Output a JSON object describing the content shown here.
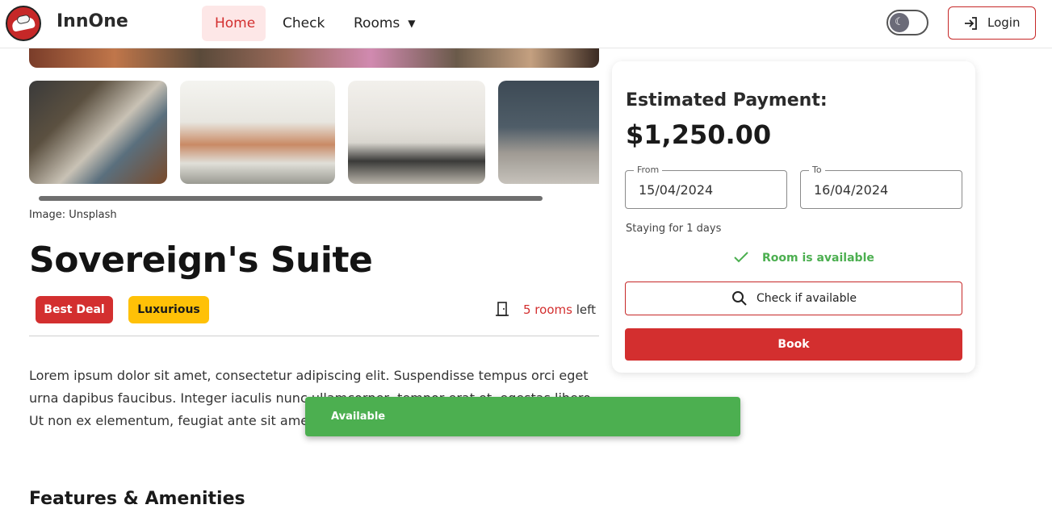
{
  "header": {
    "brand": "InnOne",
    "nav": [
      {
        "label": "Home"
      },
      {
        "label": "Check"
      },
      {
        "label": "Rooms"
      }
    ],
    "theme_toggle_icon": "moon-icon",
    "login_label": "Login"
  },
  "gallery": {
    "credit": "Image: Unsplash"
  },
  "room": {
    "title": "Sovereign's Suite",
    "badges": [
      "Best Deal",
      "Luxurious"
    ],
    "rooms_count": "5 rooms",
    "rooms_suffix": " left",
    "description": "Lorem ipsum dolor sit amet, consectetur adipiscing elit. Suspendisse tempus orci eget urna dapibus faucibus. Integer iaculis nunc ullamcorper, tempor erat et, egestas libero. Ut non ex elementum, feugiat ante sit amet"
  },
  "features": {
    "heading": "Features & Amenities"
  },
  "booking": {
    "estimated_label": "Estimated Payment:",
    "amount": "$1,250.00",
    "from_label": "From",
    "from_value": "15/04/2024",
    "to_label": "To",
    "to_value": "16/04/2024",
    "staying": "Staying for 1 days",
    "availability": "Room is available",
    "check_label": "Check if available",
    "book_label": "Book"
  },
  "snackbar": {
    "message": "Available"
  },
  "colors": {
    "primary": "#d32f2f",
    "success": "#4caf50",
    "badge_yellow": "#ffc107"
  }
}
